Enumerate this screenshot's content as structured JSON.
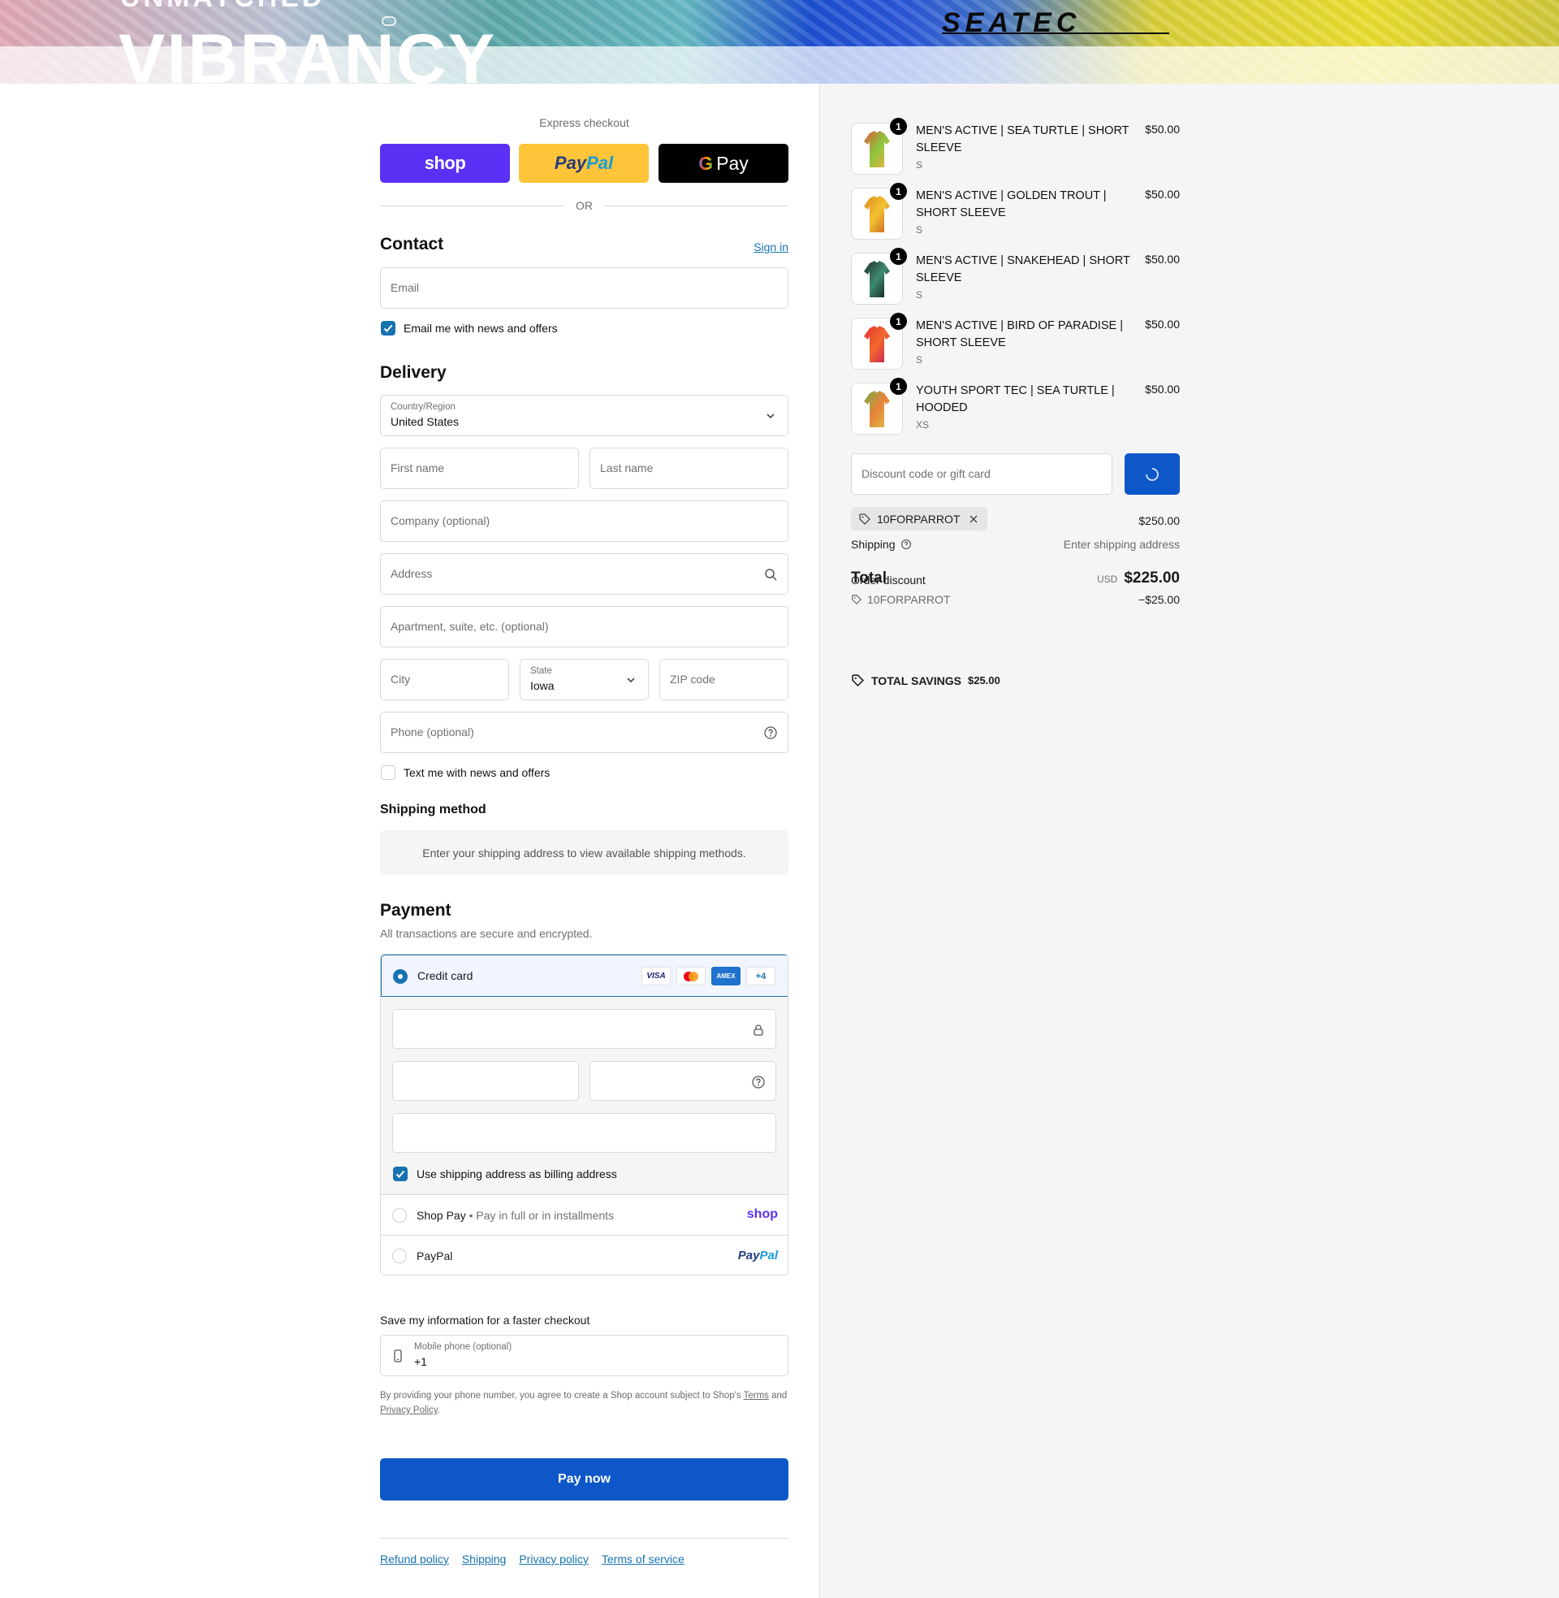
{
  "banner": {
    "tagline_top": "UNMATCHED",
    "tagline_big": "VIBRANCY",
    "brand": "SEATEC"
  },
  "express": {
    "title": "Express checkout",
    "shop_label": "shop",
    "paypal_label_a": "Pay",
    "paypal_label_b": "Pal",
    "gpay_label": "Pay",
    "gpay_g": "G",
    "or": "OR"
  },
  "contact": {
    "title": "Contact",
    "sign_in": "Sign in",
    "email_placeholder": "Email",
    "news_label": "Email me with news and offers",
    "news_checked": true
  },
  "delivery": {
    "title": "Delivery",
    "country_label": "Country/Region",
    "country_value": "United States",
    "first_name": "First name",
    "last_name": "Last name",
    "company": "Company (optional)",
    "address": "Address",
    "apartment": "Apartment, suite, etc. (optional)",
    "city": "City",
    "state_label": "State",
    "state_value": "Iowa",
    "zip": "ZIP code",
    "phone": "Phone (optional)",
    "text_label": "Text me with news and offers",
    "text_checked": false
  },
  "shipping_method": {
    "title": "Shipping method",
    "note": "Enter your shipping address to view available shipping methods."
  },
  "payment": {
    "title": "Payment",
    "subtitle": "All transactions are secure and encrypted.",
    "credit_card": "Credit card",
    "cards": [
      "VISA",
      "MC",
      "AMEX",
      "+4"
    ],
    "billing_label": "Use shipping address as billing address",
    "shop_pay": "Shop Pay",
    "shop_pay_sub": "Pay in full or in installments",
    "shop_pay_logo": "shop",
    "paypal": "PayPal",
    "paypal_logo_a": "Pay",
    "paypal_logo_b": "Pal"
  },
  "save_info": {
    "title": "Save my information for a faster checkout",
    "mobile_label": "Mobile phone (optional)",
    "mobile_value": "+1",
    "legal_a": "By providing your phone number, you agree to create a Shop account subject to Shop's",
    "terms": "Terms",
    "legal_and": "and",
    "privacy": "Privacy Policy",
    "period": "."
  },
  "pay_now": "Pay now",
  "footer_links": [
    "Refund policy",
    "Shipping",
    "Privacy policy",
    "Terms of service"
  ],
  "cart": {
    "items": [
      {
        "name": "MEN'S ACTIVE | SEA TURTLE | SHORT SLEEVE",
        "variant": "S",
        "price": "$50.00",
        "qty": "1",
        "colors": [
          "#e0563a",
          "#8cc63f",
          "#f0b13a"
        ]
      },
      {
        "name": "MEN'S ACTIVE | GOLDEN TROUT | SHORT SLEEVE",
        "variant": "S",
        "price": "$50.00",
        "qty": "1",
        "colors": [
          "#e08a1f",
          "#f2c230",
          "#c65a1e"
        ]
      },
      {
        "name": "MEN'S ACTIVE | SNAKEHEAD | SHORT SLEEVE",
        "variant": "S",
        "price": "$50.00",
        "qty": "1",
        "colors": [
          "#1f2b2b",
          "#3f8a72",
          "#0e1414"
        ]
      },
      {
        "name": "MEN'S ACTIVE | BIRD OF PARADISE | SHORT SLEEVE",
        "variant": "S",
        "price": "$50.00",
        "qty": "1",
        "colors": [
          "#e0302e",
          "#f26a2d",
          "#c2185b"
        ]
      },
      {
        "name": "YOUTH SPORT TEC | SEA TURTLE | HOODED",
        "variant": "XS",
        "price": "$50.00",
        "qty": "1",
        "colors": [
          "#6fb04a",
          "#e8823a",
          "#d6c34a"
        ]
      }
    ],
    "discount_placeholder": "Discount code or gift card",
    "applied_code": "10FORPARROT",
    "subtotal": "$250.00",
    "shipping_label": "Shipping",
    "shipping_value": "Enter shipping address",
    "total_label": "Total",
    "order_discount_label": "Order discount",
    "currency": "USD",
    "total": "$225.00",
    "discount_code": "10FORPARROT",
    "discount_value": "−$25.00",
    "savings_label": "TOTAL SAVINGS",
    "savings_value": "$25.00"
  },
  "colors": {
    "accent": "#1773b0",
    "pay_button": "#0d57c9",
    "shop_purple": "#5a31f4",
    "paypal_yellow": "#ffc439"
  }
}
